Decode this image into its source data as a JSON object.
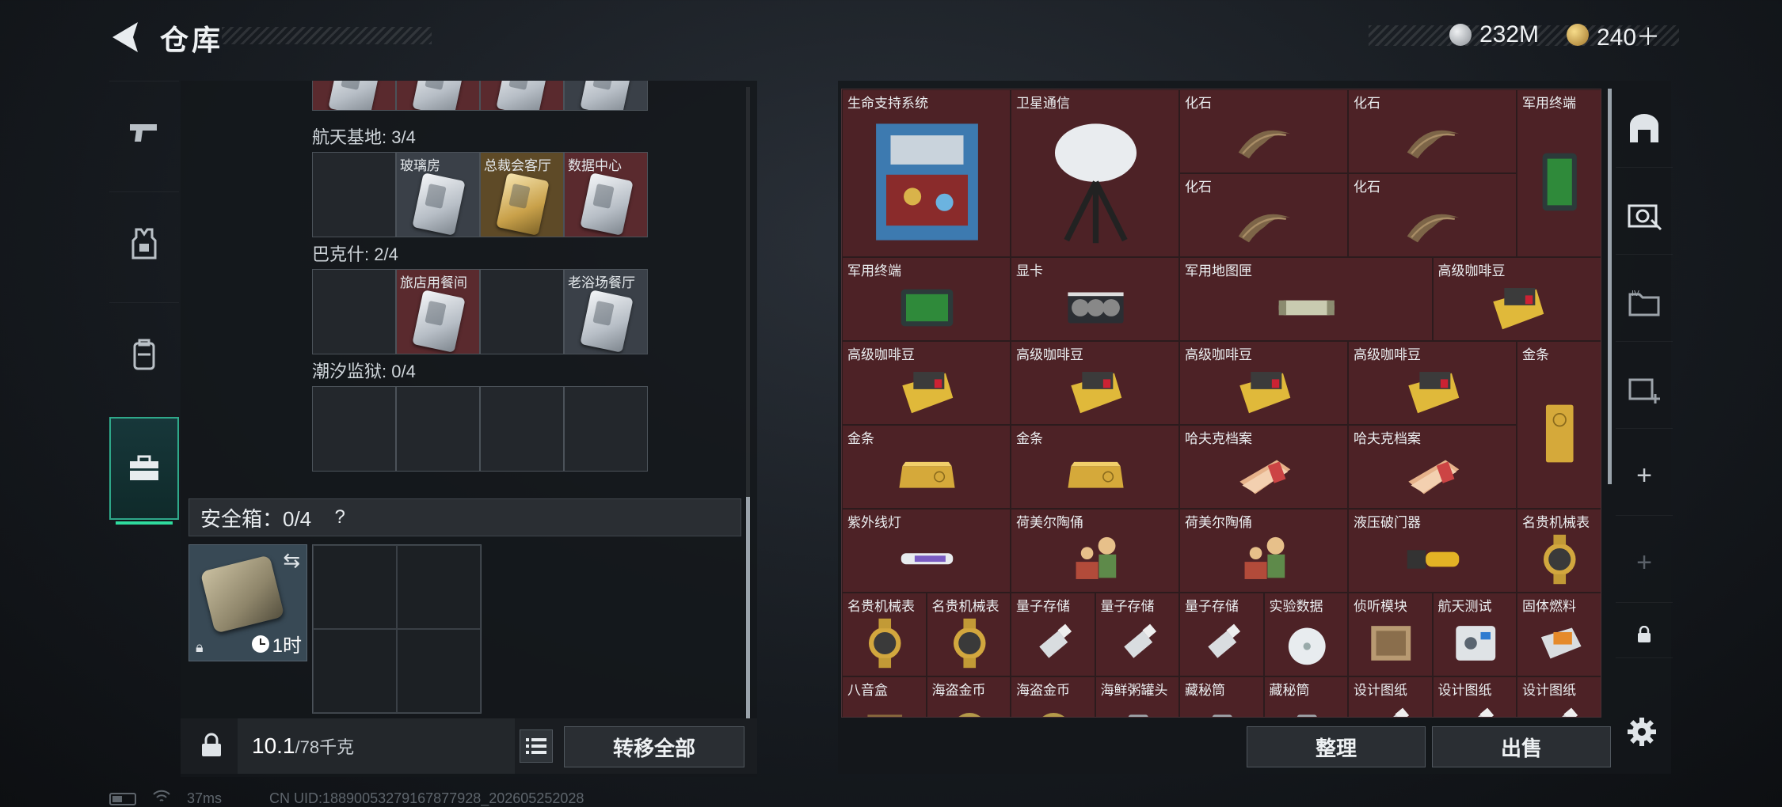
{
  "header": {
    "title": "仓库"
  },
  "currency": {
    "silver": {
      "value": "232M",
      "color": "#c8ccd0"
    },
    "gold": {
      "value": "240＋",
      "color": "#d4a848"
    }
  },
  "left_rail": {
    "tabs": [
      {
        "icon": "pistol-icon",
        "active": false
      },
      {
        "icon": "armor-vest-icon",
        "active": false
      },
      {
        "icon": "backpack-icon",
        "active": false
      },
      {
        "icon": "toolbox-icon",
        "active": true
      }
    ]
  },
  "keycards": {
    "sections": [
      {
        "label": "航天基地: 3/4",
        "slots": [
          {
            "label": "",
            "style": "empty"
          },
          {
            "label": "玻璃房",
            "style": "gray"
          },
          {
            "label": "总裁会客厅",
            "style": "gold"
          },
          {
            "label": "数据中心",
            "style": "red"
          }
        ]
      },
      {
        "label": "巴克什: 2/4",
        "slots": [
          {
            "label": "",
            "style": "empty"
          },
          {
            "label": "旅店用餐间",
            "style": "red"
          },
          {
            "label": "",
            "style": "empty"
          },
          {
            "label": "老浴场餐厅",
            "style": "gray"
          }
        ]
      },
      {
        "label": "潮汐监狱: 0/4",
        "slots": [
          {
            "label": "",
            "style": "empty"
          },
          {
            "label": "",
            "style": "empty"
          },
          {
            "label": "",
            "style": "empty"
          },
          {
            "label": "",
            "style": "empty"
          }
        ]
      }
    ]
  },
  "safe_box": {
    "header": "安全箱：0/4",
    "help": "?",
    "time": "1时"
  },
  "weight": {
    "current": "10.1",
    "max": "/78千克"
  },
  "buttons": {
    "transfer_all": "转移全部",
    "sort": "整理",
    "sell": "出售"
  },
  "stash_items": [
    {
      "label": "生命支持系统",
      "col": 0,
      "row": 0,
      "w": 1,
      "h": 2,
      "art": "machine"
    },
    {
      "label": "卫星通信",
      "col": 1,
      "row": 0,
      "w": 1,
      "h": 2,
      "art": "dish"
    },
    {
      "label": "化石",
      "col": 2,
      "row": 0,
      "w": 1,
      "h": 1,
      "art": "claw"
    },
    {
      "label": "化石",
      "col": 3,
      "row": 0,
      "w": 1,
      "h": 1,
      "art": "claw"
    },
    {
      "label": "军用终端",
      "col": 4,
      "row": 0,
      "w": 0.5,
      "h": 2,
      "art": "terminal"
    },
    {
      "label": "化石",
      "col": 2,
      "row": 1,
      "w": 1,
      "h": 1,
      "art": "claw"
    },
    {
      "label": "化石",
      "col": 3,
      "row": 1,
      "w": 1,
      "h": 1,
      "art": "claw"
    },
    {
      "label": "军用终端",
      "col": 0,
      "row": 2,
      "w": 1,
      "h": 1,
      "art": "terminal-flat"
    },
    {
      "label": "显卡",
      "col": 1,
      "row": 2,
      "w": 1,
      "h": 1,
      "art": "gpu"
    },
    {
      "label": "军用地图匣",
      "col": 2,
      "row": 2,
      "w": 1.5,
      "h": 1,
      "art": "tube"
    },
    {
      "label": "高级咖啡豆",
      "col": 3.5,
      "row": 2,
      "w": 1,
      "h": 1,
      "art": "coffee"
    },
    {
      "label": "高级咖啡豆",
      "col": 0,
      "row": 3,
      "w": 1,
      "h": 1,
      "art": "coffee"
    },
    {
      "label": "高级咖啡豆",
      "col": 1,
      "row": 3,
      "w": 1,
      "h": 1,
      "art": "coffee"
    },
    {
      "label": "高级咖啡豆",
      "col": 2,
      "row": 3,
      "w": 1,
      "h": 1,
      "art": "coffee"
    },
    {
      "label": "高级咖啡豆",
      "col": 3,
      "row": 3,
      "w": 1,
      "h": 1,
      "art": "coffee"
    },
    {
      "label": "金条",
      "col": 4,
      "row": 3,
      "w": 0.5,
      "h": 2,
      "art": "goldbar-v"
    },
    {
      "label": "金条",
      "col": 0,
      "row": 4,
      "w": 1,
      "h": 1,
      "art": "goldbar"
    },
    {
      "label": "金条",
      "col": 1,
      "row": 4,
      "w": 1,
      "h": 1,
      "art": "goldbar"
    },
    {
      "label": "哈夫克档案",
      "col": 2,
      "row": 4,
      "w": 1,
      "h": 1,
      "art": "files"
    },
    {
      "label": "哈夫克档案",
      "col": 3,
      "row": 4,
      "w": 1,
      "h": 1,
      "art": "files"
    },
    {
      "label": "紫外线灯",
      "col": 0,
      "row": 5,
      "w": 1,
      "h": 1,
      "art": "uvlamp"
    },
    {
      "label": "荷美尔陶俑",
      "col": 1,
      "row": 5,
      "w": 1,
      "h": 1,
      "art": "figurine"
    },
    {
      "label": "荷美尔陶俑",
      "col": 2,
      "row": 5,
      "w": 1,
      "h": 1,
      "art": "figurine"
    },
    {
      "label": "液压破门器",
      "col": 3,
      "row": 5,
      "w": 1,
      "h": 1,
      "art": "hydraulic"
    },
    {
      "label": "名贵机械表",
      "col": 4,
      "row": 5,
      "w": 0.5,
      "h": 1,
      "art": "watch"
    },
    {
      "label": "名贵机械表",
      "col": 0,
      "row": 6,
      "w": 0.5,
      "h": 1,
      "art": "watch"
    },
    {
      "label": "名贵机械表",
      "col": 0.5,
      "row": 6,
      "w": 0.5,
      "h": 1,
      "art": "watch"
    },
    {
      "label": "量子存储",
      "col": 1,
      "row": 6,
      "w": 0.5,
      "h": 1,
      "art": "usb"
    },
    {
      "label": "量子存储",
      "col": 1.5,
      "row": 6,
      "w": 0.5,
      "h": 1,
      "art": "usb"
    },
    {
      "label": "量子存储",
      "col": 2,
      "row": 6,
      "w": 0.5,
      "h": 1,
      "art": "usb"
    },
    {
      "label": "实验数据",
      "col": 2.5,
      "row": 6,
      "w": 0.5,
      "h": 1,
      "art": "disc"
    },
    {
      "label": "侦听模块",
      "col": 3,
      "row": 6,
      "w": 0.5,
      "h": 1,
      "art": "module"
    },
    {
      "label": "航天测试",
      "col": 3.5,
      "row": 6,
      "w": 0.5,
      "h": 1,
      "art": "device"
    },
    {
      "label": "固体燃料",
      "col": 4,
      "row": 6,
      "w": 0.5,
      "h": 1,
      "art": "fuel"
    },
    {
      "label": "八音盒",
      "col": 0,
      "row": 7,
      "w": 0.5,
      "h": 1,
      "art": "box"
    },
    {
      "label": "海盗金币",
      "col": 0.5,
      "row": 7,
      "w": 0.5,
      "h": 1,
      "art": "coin"
    },
    {
      "label": "海盗金币",
      "col": 1,
      "row": 7,
      "w": 0.5,
      "h": 1,
      "art": "coin"
    },
    {
      "label": "海鲜粥罐头",
      "col": 1.5,
      "row": 7,
      "w": 0.5,
      "h": 1,
      "art": "can"
    },
    {
      "label": "藏秘筒",
      "col": 2,
      "row": 7,
      "w": 0.5,
      "h": 1,
      "art": "can"
    },
    {
      "label": "藏秘筒",
      "col": 2.5,
      "row": 7,
      "w": 0.5,
      "h": 1,
      "art": "can"
    },
    {
      "label": "设计图纸",
      "col": 3,
      "row": 7,
      "w": 0.5,
      "h": 1,
      "art": "usb"
    },
    {
      "label": "设计图纸",
      "col": 3.5,
      "row": 7,
      "w": 0.5,
      "h": 1,
      "art": "usb"
    },
    {
      "label": "设计图纸",
      "col": 4,
      "row": 7,
      "w": 0.5,
      "h": 1,
      "art": "usb"
    }
  ],
  "status_bar": {
    "ping": "37ms",
    "uid": "CN UID:18890053279167877928_202605252028"
  }
}
